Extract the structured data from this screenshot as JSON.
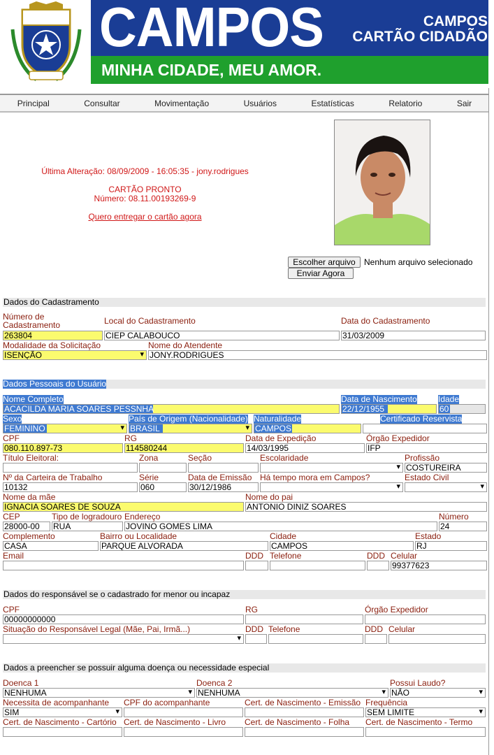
{
  "header": {
    "big_title": "CAMPOS",
    "sub_title_1": "CAMPOS",
    "sub_title_2": "CARTÃO CIDADÃO",
    "slogan": "MINHA CIDADE, MEU AMOR."
  },
  "nav": [
    "Principal",
    "Consultar",
    "Movimentação",
    "Usuários",
    "Estatísticas",
    "Relatorio",
    "Sair"
  ],
  "status": {
    "last_change": "Última Alteração: 08/09/2009 - 16:05:35 - jony.rodrigues",
    "card_ready": "CARTÃO PRONTO",
    "number": "Número: 08.11.00193269-9",
    "deliver_link": "Quero entregar o cartão agora"
  },
  "upload": {
    "choose_label": "Escolher arquivo",
    "no_file": "Nenhum arquivo selecionado",
    "send_label": "Enviar Agora"
  },
  "cadastro": {
    "title": "Dados do Cadastramento",
    "numero_label": "Número de Cadastramento",
    "numero": "263804",
    "local_label": "Local do Cadastramento",
    "local": "CIEP CALABOUCO",
    "data_label": "Data do Cadastramento",
    "data": "31/03/2009",
    "modalidade_label": "Modalidade da Solicitação",
    "modalidade": "ISENÇÃO",
    "atendente_label": "Nome do Atendente",
    "atendente": "JONY.RODRIGUES"
  },
  "pessoais": {
    "title": "Dados Pessoais do Usuário",
    "nome_label": "Nome Completo",
    "nome": "ACACILDA MARIA SOARES PESSNHA",
    "nasc_label": "Data de Nascimento",
    "nasc": "22/12/1955",
    "idade_label": "Idade",
    "idade": "60",
    "sexo_label": "Sexo",
    "sexo": "FEMININO",
    "pais_label": "País de Origem (Nacionalidade)",
    "pais": "BRASIL",
    "naturalidade_label": "Naturalidade",
    "naturalidade": "CAMPOS",
    "reservista_label": "Certificado Reservista",
    "reservista": "",
    "cpf_label": "CPF",
    "cpf": "080.110.897-73",
    "rg_label": "RG",
    "rg": "114580244",
    "expedicao_label": "Data de Expedição",
    "expedicao": "14/03/1995",
    "orgao_label": "Órgão Expedidor",
    "orgao": "IFP",
    "titulo_label": "Título Eleitoral:",
    "zona_label": "Zona",
    "secao_label": "Seção",
    "escolaridade_label": "Escolaridade",
    "profissao_label": "Profissão",
    "profissao": "COSTUREIRA",
    "carteira_label": "Nº da Carteira de Trabalho",
    "carteira": "10132",
    "serie_label": "Série",
    "serie": "060",
    "emissao_label": "Data de Emissão",
    "emissao": "30/12/1986",
    "tempo_label": "Há tempo mora em Campos?",
    "civil_label": "Estado Civil",
    "mae_label": "Nome da mãe",
    "mae": "IGNACIA SOARES DE SOUZA",
    "pai_label": "Nome do pai",
    "pai": "ANTONIO DINIZ SOARES",
    "cep_label": "CEP",
    "cep": "28000-00",
    "tipo_label": "Tipo de logradouro",
    "tipo": "RUA",
    "endereco_label": "Endereço",
    "endereco": "JOVINO GOMES LIMA",
    "numero_label": "Número",
    "numero": "24",
    "complemento_label": "Complemento",
    "complemento": "CASA",
    "bairro_label": "Bairro ou Localidade",
    "bairro": "PARQUE ALVORADA",
    "cidade_label": "Cidade",
    "cidade": "CAMPOS",
    "estado_label": "Estado",
    "estado": "RJ",
    "email_label": "Email",
    "ddd_label": "DDD",
    "telefone_label": "Telefone",
    "ddd2_label": "DDD",
    "celular_label": "Celular",
    "celular": "99377623"
  },
  "responsavel": {
    "title": "Dados do responsável se o cadastrado for menor ou incapaz",
    "cpf_label": "CPF",
    "cpf": "00000000000",
    "rg_label": "RG",
    "orgao_label": "Órgão Expedidor",
    "situacao_label": "Situação do Responsável Legal (Mãe, Pai, Irmã...)",
    "ddd_label": "DDD",
    "telefone_label": "Telefone",
    "ddd2_label": "DDD",
    "celular_label": "Celular"
  },
  "doenca": {
    "title": "Dados a preencher se possuir alguma doença ou necessidade especial",
    "doenca1_label": "Doenca 1",
    "doenca1": "NENHUMA",
    "doenca2_label": "Doenca 2",
    "doenca2": "NENHUMA",
    "laudo_label": "Possui Laudo?",
    "laudo": "NÃO",
    "acomp_label": "Necessita de acompanhante",
    "acomp": "SIM",
    "cpf_acomp_label": "CPF do acompanhante",
    "cert_emissao_label": "Cert. de Nascimento - Emissão",
    "frequencia_label": "Frequência",
    "frequencia": "SEM LIMITE",
    "cartorio_label": "Cert. de Nascimento - Cartório",
    "livro_label": "Cert. de Nascimento - Livro",
    "folha_label": "Cert. de Nascimento - Folha",
    "termo_label": "Cert. de Nascimento - Termo"
  }
}
